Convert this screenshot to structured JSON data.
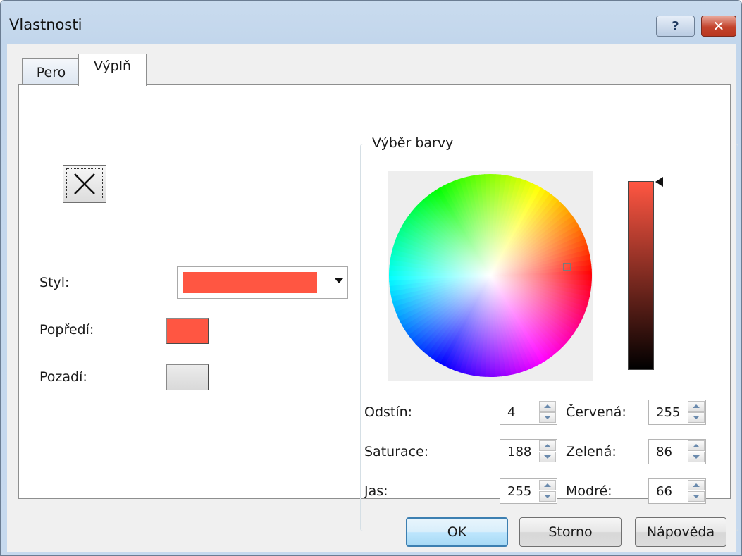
{
  "window": {
    "title": "Vlastnosti"
  },
  "titlebar": {
    "help_glyph": "?",
    "close_glyph": "✕"
  },
  "tabs": [
    {
      "label": "Pero"
    },
    {
      "label": "Výplň"
    }
  ],
  "fill": {
    "no_fill_glyph": "✕",
    "style_label": "Styl:",
    "style_swatch_color": "#ff5642",
    "foreground_label": "Popředí:",
    "foreground_color": "#ff5642",
    "background_label": "Pozadí:",
    "background_color": "#e0e0e0"
  },
  "color_picker": {
    "group_title": "Výběr barvy",
    "hue": {
      "label": "Odstín:",
      "value": "4"
    },
    "saturation": {
      "label": "Saturace:",
      "value": "188"
    },
    "brightness": {
      "label": "Jas:",
      "value": "255"
    },
    "red": {
      "label": "Červená:",
      "value": "255"
    },
    "green": {
      "label": "Zelená:",
      "value": "86"
    },
    "blue": {
      "label": "Modré:",
      "value": "66"
    },
    "selected_color": "#ff5642"
  },
  "buttons": {
    "ok": "OK",
    "cancel": "Storno",
    "help": "Nápověda"
  }
}
